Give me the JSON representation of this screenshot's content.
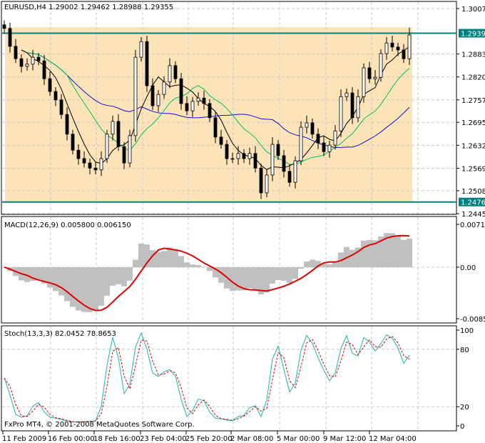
{
  "main": {
    "symbol_label": "EURUSD,H4",
    "ohlc_label": "1.29002 1.29462 1.28988 1.29355",
    "price_ticks": [
      "1.30075",
      "1.28830",
      "1.28200",
      "1.27570",
      "1.26955",
      "1.26325",
      "1.25695",
      "1.25080",
      "1.24450"
    ],
    "price_tick_values": [
      1.30075,
      1.2883,
      1.282,
      1.2757,
      1.26955,
      1.26325,
      1.25695,
      1.2508,
      1.2445
    ],
    "ylim": [
      1.2445,
      1.30075
    ],
    "hlines": [
      {
        "label": "1.29399",
        "value": 1.29399
      },
      {
        "label": "1.24769",
        "value": 1.24769
      }
    ],
    "colors": {
      "zone": "#FDE3B8",
      "hline": "#008080",
      "ma_slow": "#1010C8",
      "ma_mid": "#00C060",
      "ma_fast": "#000000"
    },
    "watermark": "FxPro MT4, © 2001-2008 MetaQuotes Software Corp."
  },
  "macd": {
    "label": "MACD(12,26,9) 0.005800 0.006150",
    "ticks": [
      "0.00715",
      "0.00",
      "-0.00859"
    ],
    "ylim": [
      -0.00859,
      0.00715
    ],
    "colors": {
      "hist": "#C0C0C0",
      "signal": "#E00000"
    }
  },
  "stoch": {
    "label": "Stoch(13,3,3) 82.0452 78.8653",
    "ticks": [
      "100",
      "80",
      "20",
      "0"
    ],
    "tick_values": [
      100,
      80,
      20,
      0
    ],
    "colors": {
      "main": "#20B2AA",
      "signal": "#E00000"
    }
  },
  "time_axis": [
    "11 Feb 2009",
    "16 Feb 00:00",
    "18 Feb 16:00",
    "23 Feb 04:00",
    "25 Feb 20:00",
    "2 Mar 08:00",
    "5 Mar 00:00",
    "9 Mar 12:00",
    "12 Mar 04:00"
  ],
  "chart_data": {
    "type": "candlestick",
    "title": "EURUSD,H4",
    "closes": [
      1.2953,
      1.2904,
      1.287,
      1.2849,
      1.2855,
      1.2874,
      1.2864,
      1.2815,
      1.278,
      1.2757,
      1.2717,
      1.2663,
      1.2619,
      1.2596,
      1.2584,
      1.257,
      1.2565,
      1.2596,
      1.2663,
      1.2698,
      1.2629,
      1.2584,
      1.2659,
      1.2874,
      1.2917,
      1.2796,
      1.2741,
      1.2772,
      1.2806,
      1.2851,
      1.2815,
      1.2747,
      1.2727,
      1.2753,
      1.2762,
      1.2747,
      1.2708,
      1.2655,
      1.2635,
      1.2596,
      1.2596,
      1.261,
      1.2596,
      1.261,
      1.257,
      1.2502,
      1.2551,
      1.2635,
      1.2604,
      1.2561,
      1.2531,
      1.259,
      1.2682,
      1.2694,
      1.2663,
      1.2639,
      1.2615,
      1.2633,
      1.2672,
      1.2766,
      1.2776,
      1.2708,
      1.2766,
      1.2845,
      1.2815,
      1.2819,
      1.2884,
      1.2913,
      1.2902,
      1.2894,
      1.287,
      1.2935
    ]
  }
}
